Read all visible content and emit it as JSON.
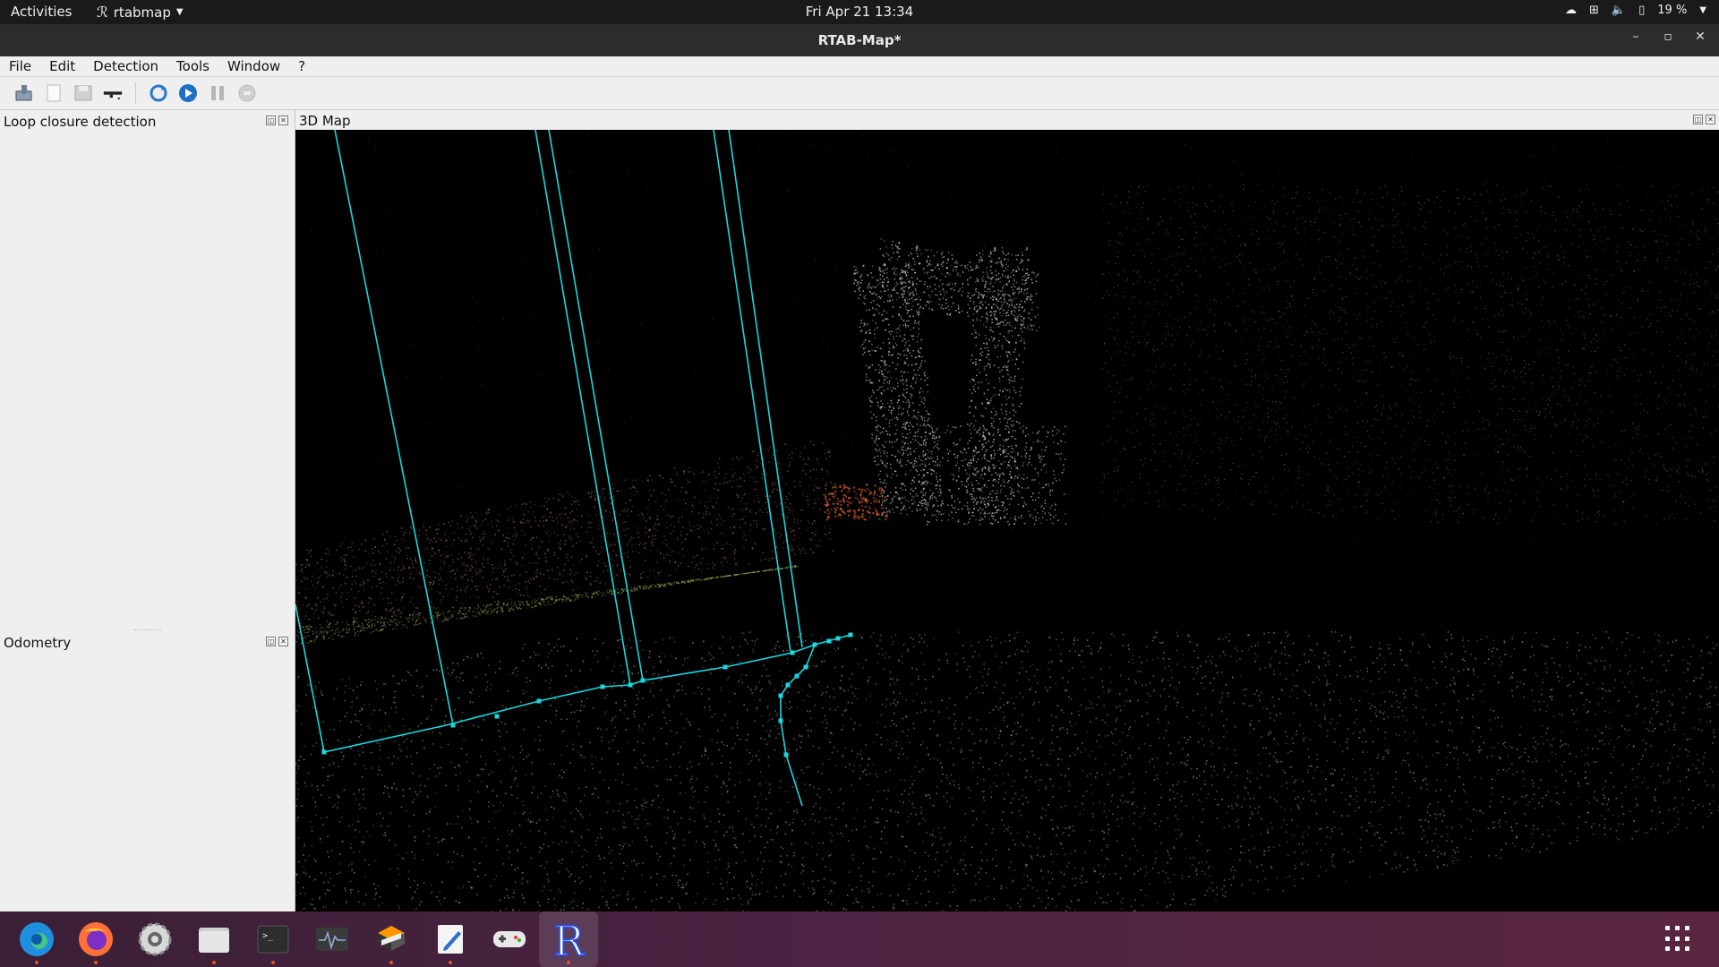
{
  "topbar": {
    "activities": "Activities",
    "app_name": "rtabmap",
    "clock": "Fri Apr 21  13:34",
    "battery": "19 %"
  },
  "window": {
    "title": "RTAB-Map*",
    "minimize": "–",
    "maximize": "▫",
    "close": "✕"
  },
  "menu": [
    "File",
    "Edit",
    "Detection",
    "Tools",
    "Window",
    "?"
  ],
  "toolbar": {
    "icons": [
      "open-database-icon",
      "new-database-icon",
      "save-icon",
      "trigger-icon",
      "refresh-icon",
      "start-icon",
      "pause-icon",
      "stop-icon"
    ]
  },
  "docks": {
    "loop_closure": "Loop closure detection",
    "odometry": "Odometry",
    "map": "3D Map"
  },
  "dock_apps": [
    "edge",
    "firefox",
    "settings",
    "files",
    "terminal",
    "system-monitor",
    "sublime",
    "text-editor",
    "games",
    "rtabmap"
  ]
}
